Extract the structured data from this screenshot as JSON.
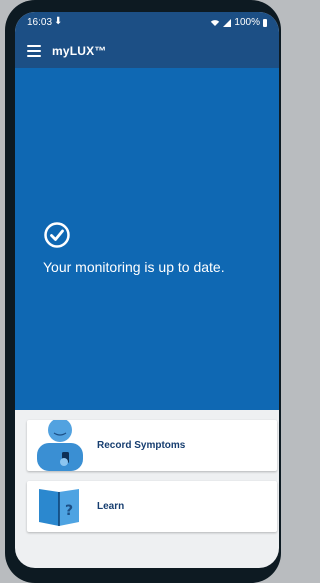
{
  "status_bar": {
    "time": "16:03",
    "download_icon": "download-arrow-icon",
    "battery_text": "100%",
    "signal_icons": [
      "wifi-icon",
      "cell-signal-icon",
      "battery-icon"
    ]
  },
  "app_bar": {
    "title": "myLUX™",
    "menu_icon": "hamburger-menu-icon"
  },
  "monitoring": {
    "status_icon": "check-circle-icon",
    "message": "Your monitoring is up to date."
  },
  "actions": [
    {
      "label": "Record Symptoms",
      "icon": "person-with-phone-illustration"
    },
    {
      "label": "Learn",
      "icon": "question-book-illustration"
    }
  ],
  "colors": {
    "app_bar": "#1c4f85",
    "hero_background": "#0f68b3",
    "card_text": "#173e70",
    "background": "#eef0f2"
  }
}
